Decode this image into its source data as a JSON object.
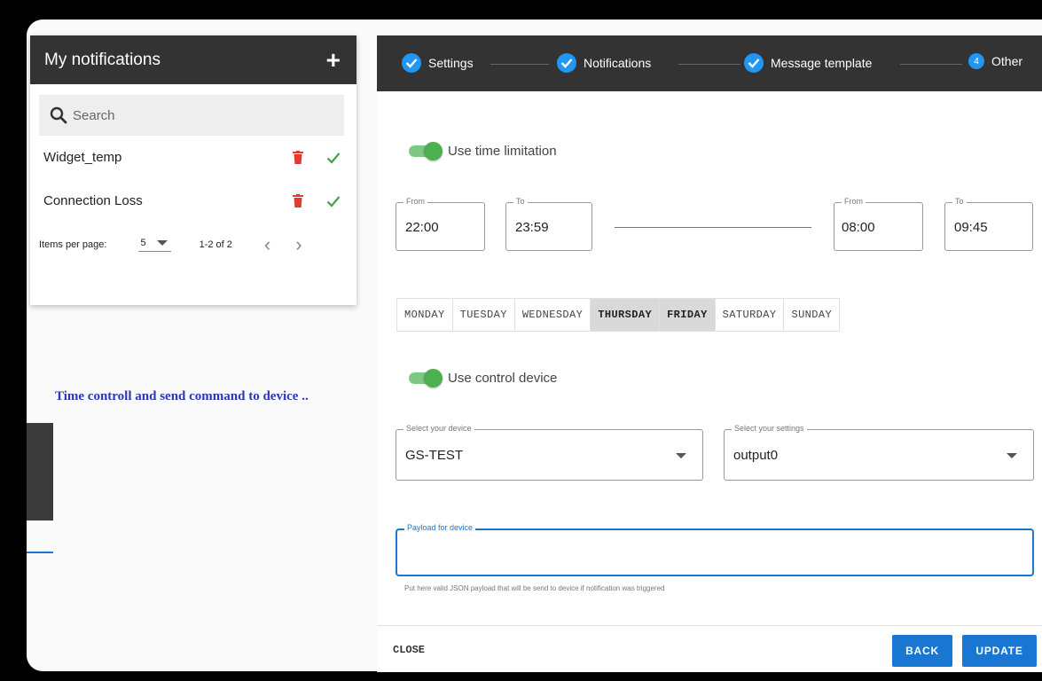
{
  "sidebar": {
    "title": "My notifications",
    "add_icon": "plus-icon",
    "search_placeholder": "Search",
    "items": [
      {
        "label": "Widget_temp"
      },
      {
        "label": "Connection Loss"
      }
    ],
    "paginator": {
      "items_per_page_label": "Items per page:",
      "page_size": "5",
      "range": "1-2 of 2"
    }
  },
  "annotation": "Time controll and send command to device ..",
  "stepper": {
    "steps": [
      {
        "label": "Settings",
        "state": "done"
      },
      {
        "label": "Notifications",
        "state": "done"
      },
      {
        "label": "Message template",
        "state": "done"
      },
      {
        "label": "Other",
        "state": "active",
        "number": "4"
      }
    ]
  },
  "time_limitation": {
    "toggle_label": "Use time limitation",
    "enabled": true,
    "range1": {
      "from_label": "From",
      "from": "22:00",
      "to_label": "To",
      "to": "23:59"
    },
    "range2": {
      "from_label": "From",
      "from": "08:00",
      "to_label": "To",
      "to": "09:45"
    }
  },
  "days": [
    {
      "label": "MONDAY",
      "selected": false
    },
    {
      "label": "TUESDAY",
      "selected": false
    },
    {
      "label": "WEDNESDAY",
      "selected": false
    },
    {
      "label": "THURSDAY",
      "selected": true
    },
    {
      "label": "FRIDAY",
      "selected": true
    },
    {
      "label": "SATURDAY",
      "selected": false
    },
    {
      "label": "SUNDAY",
      "selected": false
    }
  ],
  "control_device": {
    "toggle_label": "Use control device",
    "enabled": true,
    "device_label": "Select your device",
    "device_value": "GS-TEST",
    "settings_label": "Select your settings",
    "settings_value": "output0",
    "payload_label": "Payload for device",
    "payload_value": "",
    "hint": "Put here valid JSON payload that will be send to device if notification was triggered"
  },
  "footer": {
    "close": "CLOSE",
    "back": "BACK",
    "update": "UPDATE"
  },
  "colors": {
    "accent": "#1976d2",
    "toggle_on": "#4caf50",
    "delete": "#e53935",
    "confirm": "#43a047",
    "header": "#333333"
  }
}
